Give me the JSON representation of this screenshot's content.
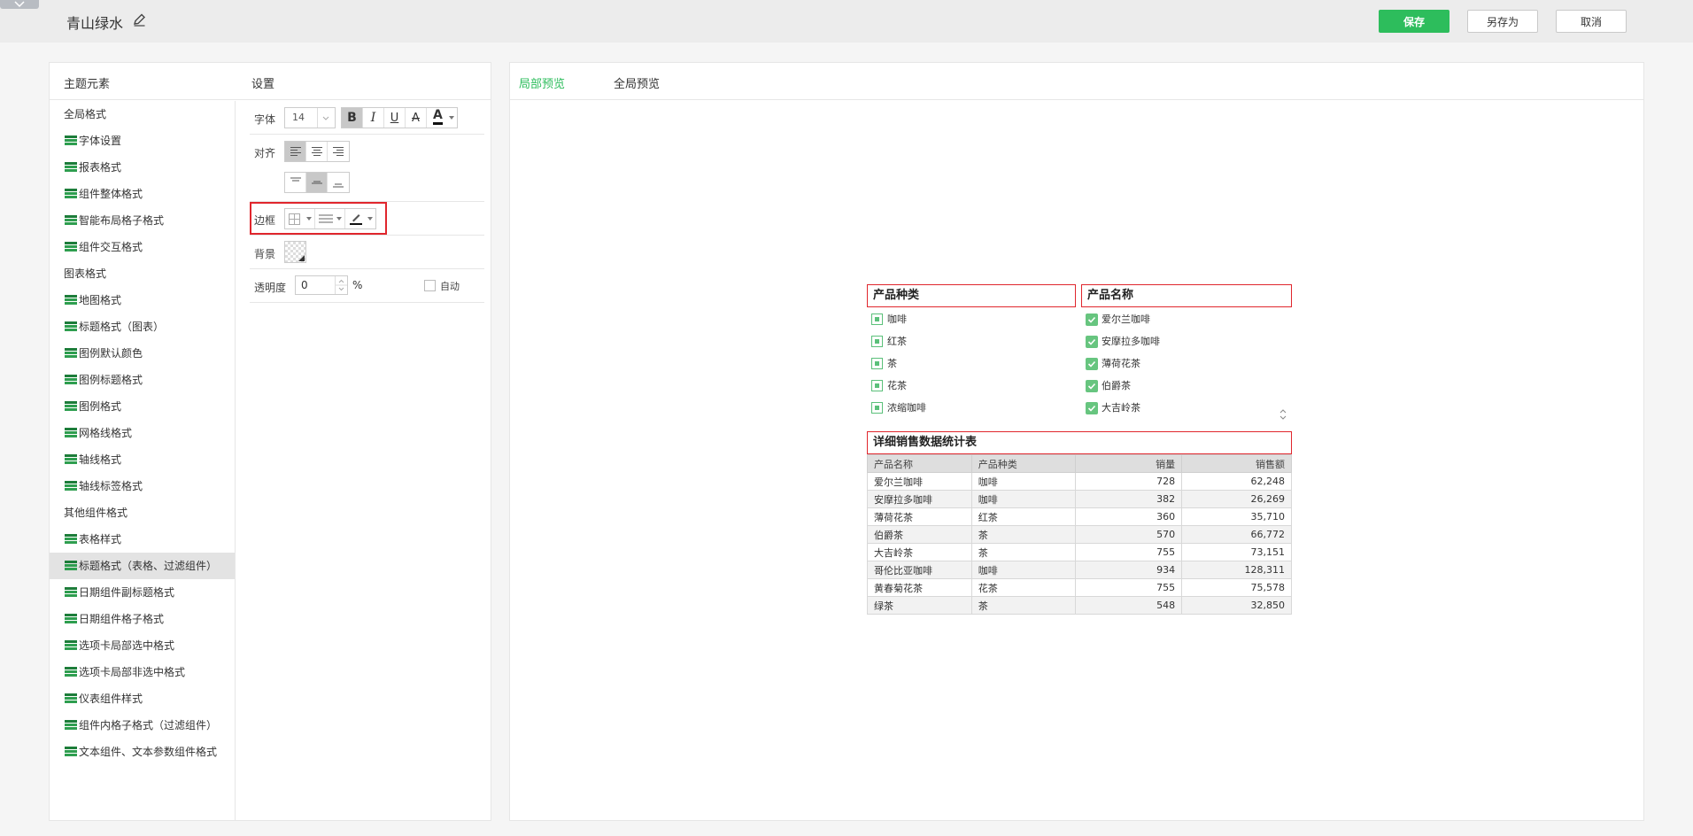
{
  "header": {
    "title": "青山绿水",
    "save_label": "保存",
    "saveas_label": "另存为",
    "cancel_label": "取消",
    "accent": "#2dbd5c"
  },
  "left_panel": {
    "elements_title": "主题元素",
    "settings_title": "设置",
    "items": [
      {
        "label": "全局格式",
        "kind": "group"
      },
      {
        "label": "字体设置",
        "kind": "item"
      },
      {
        "label": "报表格式",
        "kind": "item"
      },
      {
        "label": "组件整体格式",
        "kind": "item"
      },
      {
        "label": "智能布局格子格式",
        "kind": "item"
      },
      {
        "label": "组件交互格式",
        "kind": "item"
      },
      {
        "label": "图表格式",
        "kind": "group"
      },
      {
        "label": "地图格式",
        "kind": "item"
      },
      {
        "label": "标题格式（图表）",
        "kind": "item"
      },
      {
        "label": "图例默认颜色",
        "kind": "item"
      },
      {
        "label": "图例标题格式",
        "kind": "item"
      },
      {
        "label": "图例格式",
        "kind": "item"
      },
      {
        "label": "网格线格式",
        "kind": "item"
      },
      {
        "label": "轴线格式",
        "kind": "item"
      },
      {
        "label": "轴线标签格式",
        "kind": "item"
      },
      {
        "label": "其他组件格式",
        "kind": "group"
      },
      {
        "label": "表格样式",
        "kind": "item"
      },
      {
        "label": "标题格式（表格、过滤组件）",
        "kind": "item",
        "selected": true
      },
      {
        "label": "日期组件副标题格式",
        "kind": "item"
      },
      {
        "label": "日期组件格子格式",
        "kind": "item"
      },
      {
        "label": "选项卡局部选中格式",
        "kind": "item"
      },
      {
        "label": "选项卡局部非选中格式",
        "kind": "item"
      },
      {
        "label": "仪表组件样式",
        "kind": "item"
      },
      {
        "label": "组件内格子格式（过滤组件）",
        "kind": "item"
      },
      {
        "label": "文本组件、文本参数组件格式",
        "kind": "item"
      }
    ]
  },
  "settings": {
    "font_label": "字体",
    "font_size": "14",
    "bold": "B",
    "italic": "I",
    "underline": "U",
    "strike": "A",
    "font_color_glyph": "A",
    "align_label": "对齐",
    "border_label": "边框",
    "background_label": "背景",
    "opacity_label": "透明度",
    "opacity_value": "0",
    "percent": "%",
    "auto_label": "自动",
    "highlight_color": "#e0262d"
  },
  "preview": {
    "tab_local": "局部预览",
    "tab_global": "全局预览",
    "category_filter": {
      "title": "产品种类",
      "items": [
        "咖啡",
        "红茶",
        "茶",
        "花茶",
        "浓缩咖啡"
      ]
    },
    "name_filter": {
      "title": "产品名称",
      "items": [
        "爱尔兰咖啡",
        "安摩拉多咖啡",
        "薄荷花茶",
        "伯爵茶",
        "大吉岭茶"
      ]
    },
    "table": {
      "title": "详细销售数据统计表",
      "columns": [
        "产品名称",
        "产品种类",
        "销量",
        "销售额"
      ],
      "rows": [
        [
          "爱尔兰咖啡",
          "咖啡",
          "728",
          "62,248"
        ],
        [
          "安摩拉多咖啡",
          "咖啡",
          "382",
          "26,269"
        ],
        [
          "薄荷花茶",
          "红茶",
          "360",
          "35,710"
        ],
        [
          "伯爵茶",
          "茶",
          "570",
          "66,772"
        ],
        [
          "大吉岭茶",
          "茶",
          "755",
          "73,151"
        ],
        [
          "哥伦比亚咖啡",
          "咖啡",
          "934",
          "128,311"
        ],
        [
          "黄春菊花茶",
          "花茶",
          "755",
          "75,578"
        ],
        [
          "绿茶",
          "茶",
          "548",
          "32,850"
        ]
      ]
    }
  }
}
